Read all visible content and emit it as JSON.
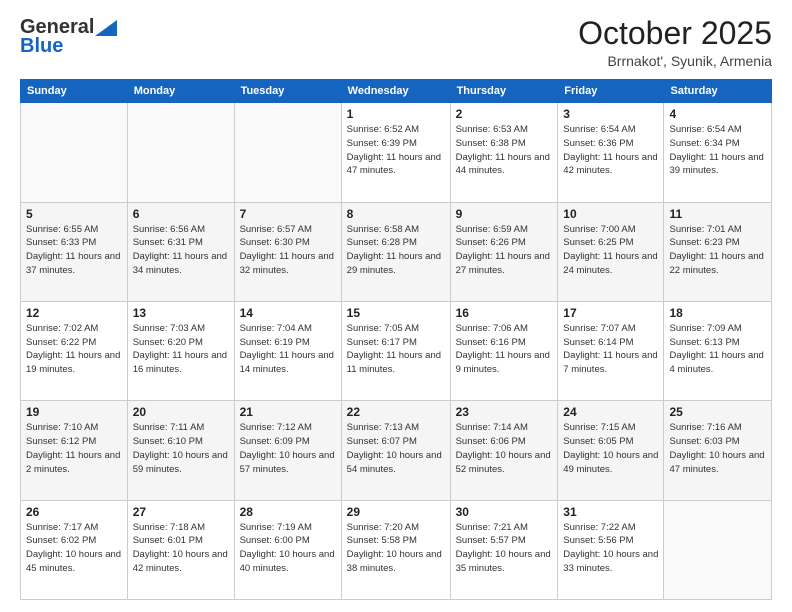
{
  "header": {
    "logo_general": "General",
    "logo_blue": "Blue",
    "month_title": "October 2025",
    "location": "Brrnakot', Syunik, Armenia"
  },
  "days_of_week": [
    "Sunday",
    "Monday",
    "Tuesday",
    "Wednesday",
    "Thursday",
    "Friday",
    "Saturday"
  ],
  "weeks": [
    [
      {
        "day": "",
        "info": ""
      },
      {
        "day": "",
        "info": ""
      },
      {
        "day": "",
        "info": ""
      },
      {
        "day": "1",
        "info": "Sunrise: 6:52 AM\nSunset: 6:39 PM\nDaylight: 11 hours and 47 minutes."
      },
      {
        "day": "2",
        "info": "Sunrise: 6:53 AM\nSunset: 6:38 PM\nDaylight: 11 hours and 44 minutes."
      },
      {
        "day": "3",
        "info": "Sunrise: 6:54 AM\nSunset: 6:36 PM\nDaylight: 11 hours and 42 minutes."
      },
      {
        "day": "4",
        "info": "Sunrise: 6:54 AM\nSunset: 6:34 PM\nDaylight: 11 hours and 39 minutes."
      }
    ],
    [
      {
        "day": "5",
        "info": "Sunrise: 6:55 AM\nSunset: 6:33 PM\nDaylight: 11 hours and 37 minutes."
      },
      {
        "day": "6",
        "info": "Sunrise: 6:56 AM\nSunset: 6:31 PM\nDaylight: 11 hours and 34 minutes."
      },
      {
        "day": "7",
        "info": "Sunrise: 6:57 AM\nSunset: 6:30 PM\nDaylight: 11 hours and 32 minutes."
      },
      {
        "day": "8",
        "info": "Sunrise: 6:58 AM\nSunset: 6:28 PM\nDaylight: 11 hours and 29 minutes."
      },
      {
        "day": "9",
        "info": "Sunrise: 6:59 AM\nSunset: 6:26 PM\nDaylight: 11 hours and 27 minutes."
      },
      {
        "day": "10",
        "info": "Sunrise: 7:00 AM\nSunset: 6:25 PM\nDaylight: 11 hours and 24 minutes."
      },
      {
        "day": "11",
        "info": "Sunrise: 7:01 AM\nSunset: 6:23 PM\nDaylight: 11 hours and 22 minutes."
      }
    ],
    [
      {
        "day": "12",
        "info": "Sunrise: 7:02 AM\nSunset: 6:22 PM\nDaylight: 11 hours and 19 minutes."
      },
      {
        "day": "13",
        "info": "Sunrise: 7:03 AM\nSunset: 6:20 PM\nDaylight: 11 hours and 16 minutes."
      },
      {
        "day": "14",
        "info": "Sunrise: 7:04 AM\nSunset: 6:19 PM\nDaylight: 11 hours and 14 minutes."
      },
      {
        "day": "15",
        "info": "Sunrise: 7:05 AM\nSunset: 6:17 PM\nDaylight: 11 hours and 11 minutes."
      },
      {
        "day": "16",
        "info": "Sunrise: 7:06 AM\nSunset: 6:16 PM\nDaylight: 11 hours and 9 minutes."
      },
      {
        "day": "17",
        "info": "Sunrise: 7:07 AM\nSunset: 6:14 PM\nDaylight: 11 hours and 7 minutes."
      },
      {
        "day": "18",
        "info": "Sunrise: 7:09 AM\nSunset: 6:13 PM\nDaylight: 11 hours and 4 minutes."
      }
    ],
    [
      {
        "day": "19",
        "info": "Sunrise: 7:10 AM\nSunset: 6:12 PM\nDaylight: 11 hours and 2 minutes."
      },
      {
        "day": "20",
        "info": "Sunrise: 7:11 AM\nSunset: 6:10 PM\nDaylight: 10 hours and 59 minutes."
      },
      {
        "day": "21",
        "info": "Sunrise: 7:12 AM\nSunset: 6:09 PM\nDaylight: 10 hours and 57 minutes."
      },
      {
        "day": "22",
        "info": "Sunrise: 7:13 AM\nSunset: 6:07 PM\nDaylight: 10 hours and 54 minutes."
      },
      {
        "day": "23",
        "info": "Sunrise: 7:14 AM\nSunset: 6:06 PM\nDaylight: 10 hours and 52 minutes."
      },
      {
        "day": "24",
        "info": "Sunrise: 7:15 AM\nSunset: 6:05 PM\nDaylight: 10 hours and 49 minutes."
      },
      {
        "day": "25",
        "info": "Sunrise: 7:16 AM\nSunset: 6:03 PM\nDaylight: 10 hours and 47 minutes."
      }
    ],
    [
      {
        "day": "26",
        "info": "Sunrise: 7:17 AM\nSunset: 6:02 PM\nDaylight: 10 hours and 45 minutes."
      },
      {
        "day": "27",
        "info": "Sunrise: 7:18 AM\nSunset: 6:01 PM\nDaylight: 10 hours and 42 minutes."
      },
      {
        "day": "28",
        "info": "Sunrise: 7:19 AM\nSunset: 6:00 PM\nDaylight: 10 hours and 40 minutes."
      },
      {
        "day": "29",
        "info": "Sunrise: 7:20 AM\nSunset: 5:58 PM\nDaylight: 10 hours and 38 minutes."
      },
      {
        "day": "30",
        "info": "Sunrise: 7:21 AM\nSunset: 5:57 PM\nDaylight: 10 hours and 35 minutes."
      },
      {
        "day": "31",
        "info": "Sunrise: 7:22 AM\nSunset: 5:56 PM\nDaylight: 10 hours and 33 minutes."
      },
      {
        "day": "",
        "info": ""
      }
    ]
  ]
}
